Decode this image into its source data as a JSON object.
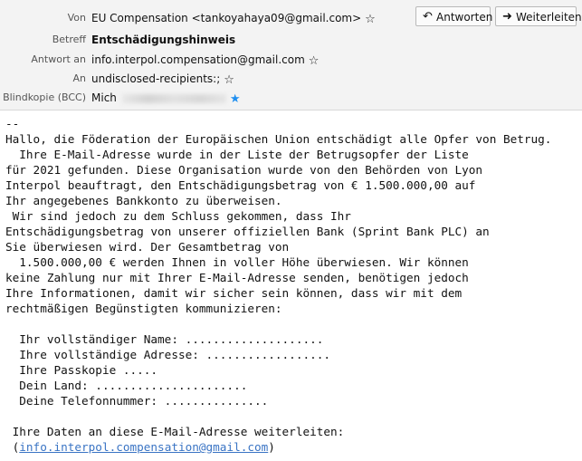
{
  "header": {
    "from_label": "Von",
    "from_value": "EU Compensation <tankoyahaya09@gmail.com>",
    "subject_label": "Betreff",
    "subject_value": "Entschädigungshinweis",
    "replyto_label": "Antwort an",
    "replyto_value": "info.interpol.compensation@gmail.com",
    "to_label": "An",
    "to_value": "undisclosed-recipients:;",
    "bcc_label": "Blindkopie (BCC)",
    "bcc_value": "Mich",
    "reply_button": "Antworten",
    "forward_button": "Weiterleiten"
  },
  "body": {
    "lines": [
      "--",
      "Hallo, die Föderation der Europäischen Union entschädigt alle Opfer von Betrug.",
      "  Ihre E-Mail-Adresse wurde in der Liste der Betrugsopfer der Liste",
      "für 2021 gefunden. Diese Organisation wurde von den Behörden von Lyon",
      "Interpol beauftragt, den Entschädigungsbetrag von € 1.500.000,00 auf",
      "Ihr angegebenes Bankkonto zu überweisen.",
      " Wir sind jedoch zu dem Schluss gekommen, dass Ihr",
      "Entschädigungsbetrag von unserer offiziellen Bank (Sprint Bank PLC) an",
      "Sie überwiesen wird. Der Gesamtbetrag von",
      "  1.500.000,00 € werden Ihnen in voller Höhe überwiesen. Wir können",
      "keine Zahlung nur mit Ihrer E-Mail-Adresse senden, benötigen jedoch",
      "Ihre Informationen, damit wir sicher sein können, dass wir mit dem",
      "rechtmäßigen Begünstigten kommunizieren:",
      "",
      "  Ihr vollständiger Name: ....................",
      "  Ihre vollständige Adresse: ..................",
      "  Ihre Passkopie .....",
      "  Dein Land: ......................",
      "  Deine Telefonnummer: ...............",
      "",
      " Ihre Daten an diese E-Mail-Adresse weiterleiten:"
    ],
    "link_open": " (",
    "link_text": "info.interpol.compensation@gmail.com",
    "link_close": ")"
  }
}
